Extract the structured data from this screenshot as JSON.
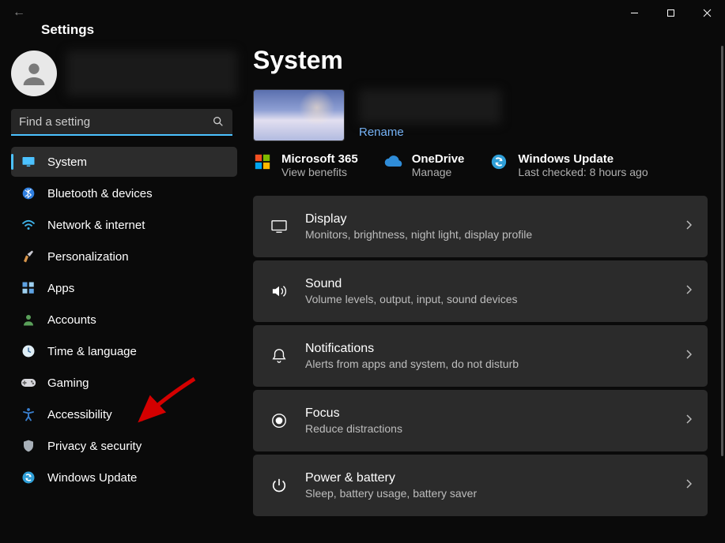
{
  "window": {
    "title": "Settings"
  },
  "user": {
    "avatar": true
  },
  "search": {
    "placeholder": "Find a setting"
  },
  "sidebar": {
    "items": [
      {
        "label": "System",
        "icon": "monitor",
        "selected": true
      },
      {
        "label": "Bluetooth & devices",
        "icon": "bluetooth"
      },
      {
        "label": "Network & internet",
        "icon": "wifi"
      },
      {
        "label": "Personalization",
        "icon": "brush"
      },
      {
        "label": "Apps",
        "icon": "apps"
      },
      {
        "label": "Accounts",
        "icon": "person"
      },
      {
        "label": "Time & language",
        "icon": "clock"
      },
      {
        "label": "Gaming",
        "icon": "gaming"
      },
      {
        "label": "Accessibility",
        "icon": "accessibility"
      },
      {
        "label": "Privacy & security",
        "icon": "shield"
      },
      {
        "label": "Windows Update",
        "icon": "update"
      }
    ]
  },
  "main": {
    "title": "System",
    "device": {
      "rename": "Rename"
    },
    "links": [
      {
        "icon": "ms365",
        "title": "Microsoft 365",
        "sub": "View benefits"
      },
      {
        "icon": "onedrive",
        "title": "OneDrive",
        "sub": "Manage"
      },
      {
        "icon": "winupdate",
        "title": "Windows Update",
        "sub": "Last checked: 8 hours ago"
      }
    ],
    "cards": [
      {
        "icon": "display",
        "title": "Display",
        "sub": "Monitors, brightness, night light, display profile"
      },
      {
        "icon": "sound",
        "title": "Sound",
        "sub": "Volume levels, output, input, sound devices"
      },
      {
        "icon": "notifications",
        "title": "Notifications",
        "sub": "Alerts from apps and system, do not disturb"
      },
      {
        "icon": "focus",
        "title": "Focus",
        "sub": "Reduce distractions"
      },
      {
        "icon": "power",
        "title": "Power & battery",
        "sub": "Sleep, battery usage, battery saver"
      }
    ]
  },
  "annotation": {
    "arrow_target": "Accessibility"
  }
}
